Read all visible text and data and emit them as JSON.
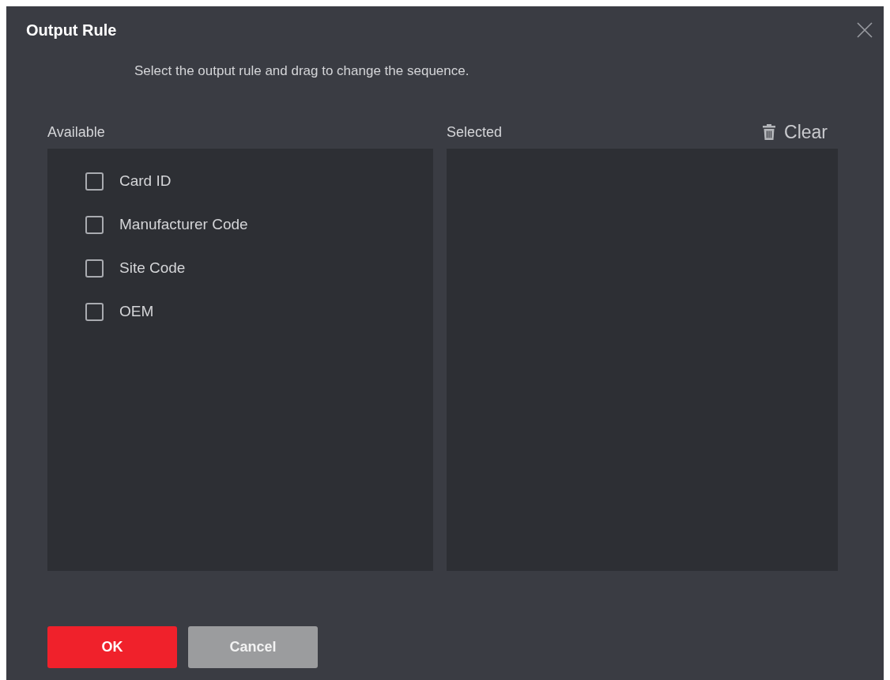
{
  "dialog": {
    "title": "Output Rule",
    "instruction": "Select the output rule and drag to change the sequence.",
    "available": {
      "label": "Available",
      "items": [
        {
          "label": "Card ID",
          "checked": false
        },
        {
          "label": "Manufacturer Code",
          "checked": false
        },
        {
          "label": "Site Code",
          "checked": false
        },
        {
          "label": "OEM",
          "checked": false
        }
      ]
    },
    "selected": {
      "label": "Selected",
      "clear_button": "Clear"
    },
    "buttons": [
      {
        "label": "OK",
        "kind": "primary"
      },
      {
        "label": "Cancel",
        "kind": "secondary"
      }
    ]
  }
}
